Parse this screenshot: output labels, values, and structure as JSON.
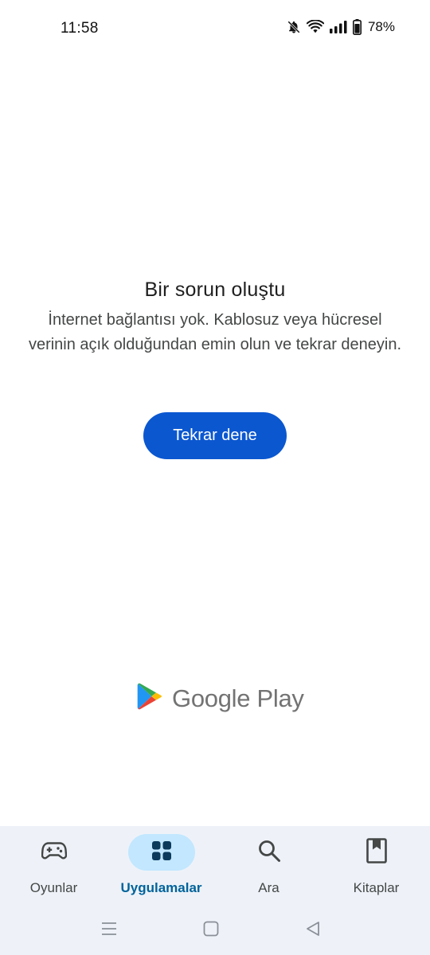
{
  "status_bar": {
    "time": "11:58",
    "battery_percent": "78%",
    "icons": [
      "bell-off-icon",
      "wifi-icon",
      "signal-icon",
      "battery-icon"
    ]
  },
  "error": {
    "title": "Bir sorun oluştu",
    "message": "İnternet bağlantısı yok. Kablosuz veya hücresel verinin açık olduğundan emin olun ve tekrar deneyin."
  },
  "retry_button_label": "Tekrar dene",
  "brand": {
    "text": "Google Play",
    "icon": "play-logo-icon"
  },
  "bottom_nav": {
    "items": [
      {
        "label": "Oyunlar",
        "icon": "gamepad-icon",
        "active": false
      },
      {
        "label": "Uygulamalar",
        "icon": "apps-grid-icon",
        "active": true
      },
      {
        "label": "Ara",
        "icon": "search-icon",
        "active": false
      },
      {
        "label": "Kitaplar",
        "icon": "book-icon",
        "active": false
      }
    ]
  },
  "system_nav": [
    "menu-icon",
    "home-icon",
    "back-icon"
  ],
  "colors": {
    "accent": "#0b57d0",
    "nav_background": "#eef2f8",
    "active_pill": "#c2e7ff",
    "active_label": "#00639b"
  }
}
